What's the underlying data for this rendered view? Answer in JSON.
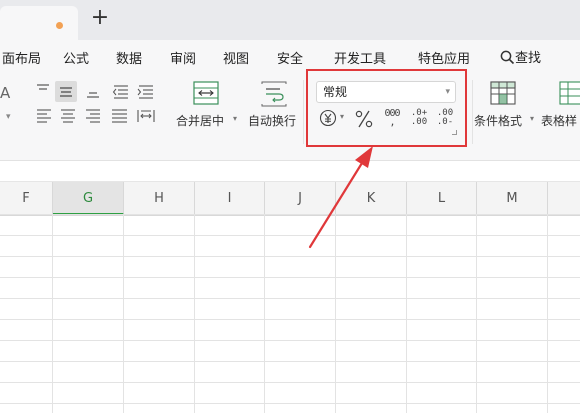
{
  "tab_bar": {
    "new_tab_label": "+"
  },
  "menu": {
    "items": [
      "面布局",
      "公式",
      "数据",
      "审阅",
      "视图",
      "安全",
      "开发工具",
      "特色应用"
    ],
    "search_label": "查找"
  },
  "ribbon": {
    "partial_left_label": "A",
    "merge_label": "合并居中",
    "wrap_label": "自动换行",
    "number_format": {
      "selected": "常规"
    },
    "conditional_format_label": "条件格式",
    "table_style_label": "表格样"
  },
  "columns": [
    "F",
    "G",
    "H",
    "I",
    "J",
    "K",
    "L",
    "M"
  ],
  "selected_column": "G",
  "colors": {
    "highlight": "#e0383a",
    "selected_col_accent": "#2ea043",
    "tab_dot": "#f2a154"
  }
}
